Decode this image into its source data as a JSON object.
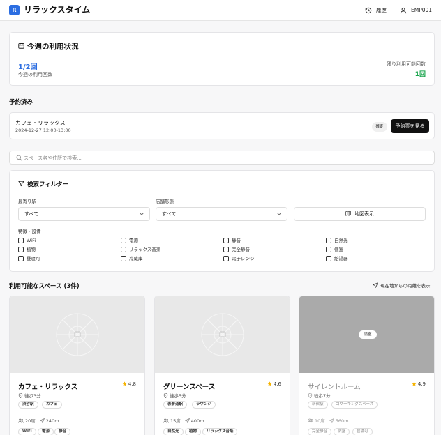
{
  "header": {
    "logo_letter": "R",
    "app_title": "リラックスタイム",
    "history_label": "履歴",
    "user_id": "EMP001"
  },
  "usage": {
    "title": "今週の利用状況",
    "count": "1/2回",
    "count_label": "今週の利用回数",
    "remaining_label": "残り利用可能回数",
    "remaining_value": "1回"
  },
  "reserved": {
    "heading": "予約済み",
    "name": "カフェ・リラックス",
    "datetime": "2024-12-27 12:00-13:00",
    "status_badge": "確定",
    "ticket_button": "予約票を見る"
  },
  "search": {
    "placeholder": "スペース名や住所で検索..."
  },
  "filter": {
    "title": "検索フィルター",
    "station_label": "最寄り駅",
    "station_value": "すべて",
    "type_label": "店舗形態",
    "type_value": "すべて",
    "map_button": "地図表示",
    "features_label": "特徴・設備",
    "features": [
      "WiFi",
      "電源",
      "静音",
      "自然光",
      "植物",
      "リラックス音楽",
      "完全静音",
      "個室",
      "昼寝可",
      "冷蔵庫",
      "電子レンジ",
      "給湯器"
    ]
  },
  "available": {
    "heading": "利用可能なスペース (3件)",
    "distance_link": "現在地からの距離を表示"
  },
  "spaces": [
    {
      "name": "カフェ・リラックス",
      "rating": "4.8",
      "walk": "徒歩3分",
      "tags": [
        "渋谷駅",
        "カフェ"
      ],
      "seats": "20席",
      "distance": "240m",
      "features": [
        "WiFi",
        "電源",
        "静音"
      ]
    },
    {
      "name": "グリーンスペース",
      "rating": "4.6",
      "walk": "徒歩5分",
      "tags": [
        "表参道駅",
        "ラウンジ"
      ],
      "seats": "15席",
      "distance": "400m",
      "features": [
        "自然光",
        "植物",
        "リラックス音楽"
      ]
    },
    {
      "name": "サイレントルーム",
      "rating": "4.9",
      "walk": "徒歩7分",
      "tags": [
        "新宿駅",
        "コワーキングスペース"
      ],
      "seats": "10席",
      "distance": "560m",
      "features": [
        "完全静音",
        "個室",
        "昼寝可"
      ],
      "overlay_badge": "満室"
    }
  ],
  "colors": {
    "accent": "#2b6de1",
    "remaining": "#16a34a",
    "primary_button": "#111111",
    "star": "#f5b301"
  }
}
